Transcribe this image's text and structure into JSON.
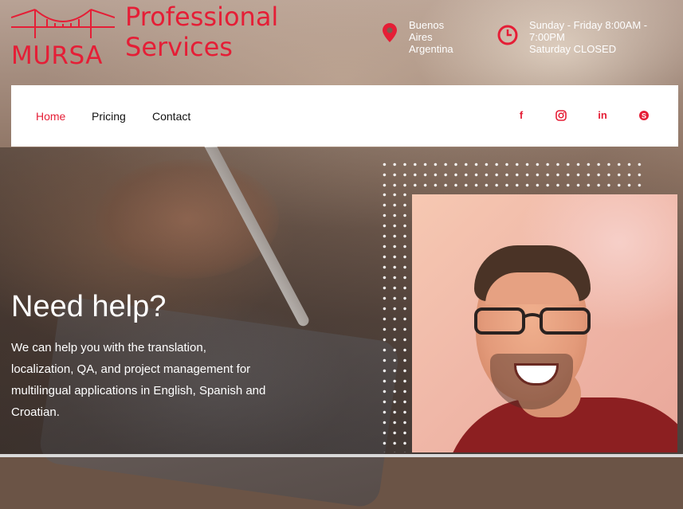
{
  "brand": {
    "logo_text": "MURSA",
    "title_line1": "Professional",
    "title_line2": "Services",
    "accent_color": "#e51e36"
  },
  "header_info": {
    "location": {
      "icon": "map-pin-icon",
      "line1": "Buenos",
      "line2": "Aires",
      "line3": "Argentina"
    },
    "hours": {
      "icon": "clock-icon",
      "line1": "Sunday - Friday 8:00AM -",
      "line2": "7:00PM",
      "line3": "Saturday CLOSED"
    }
  },
  "nav": {
    "items": [
      {
        "label": "Home",
        "active": true
      },
      {
        "label": "Pricing",
        "active": false
      },
      {
        "label": "Contact",
        "active": false
      }
    ],
    "social": [
      {
        "icon": "facebook-icon",
        "glyph": "f"
      },
      {
        "icon": "instagram-icon",
        "glyph": "◎"
      },
      {
        "icon": "linkedin-icon",
        "glyph": "in"
      },
      {
        "icon": "skype-icon",
        "glyph": "S"
      }
    ]
  },
  "hero": {
    "title": "Need help?",
    "text": "We can help you with the translation, localization, QA, and project management for multilingual applications in English, Spanish and Croatian."
  }
}
